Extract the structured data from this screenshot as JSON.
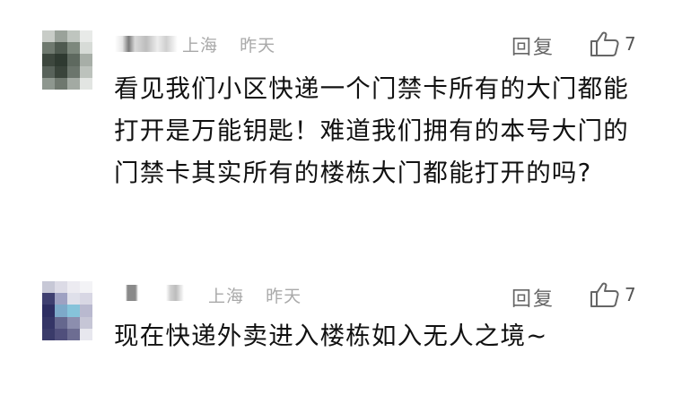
{
  "comments": [
    {
      "location": "上海",
      "time": "昨天",
      "reply_label": "回复",
      "like_count": "7",
      "text": "看见我们小区快递一个门禁卡所有的大门都能打开是万能钥匙！难道我们拥有的本号大门的门禁卡其实所有的楼栋大门都能打开的吗?"
    },
    {
      "location": "上海",
      "time": "昨天",
      "reply_label": "回复",
      "like_count": "7",
      "text": "现在快递外卖进入楼栋如入无人之境~"
    }
  ],
  "colors": {
    "meta_text": "#a9a9a9",
    "action_text": "#666666",
    "body_text": "#111111"
  },
  "icons": {
    "like": "thumbs-up-icon"
  }
}
